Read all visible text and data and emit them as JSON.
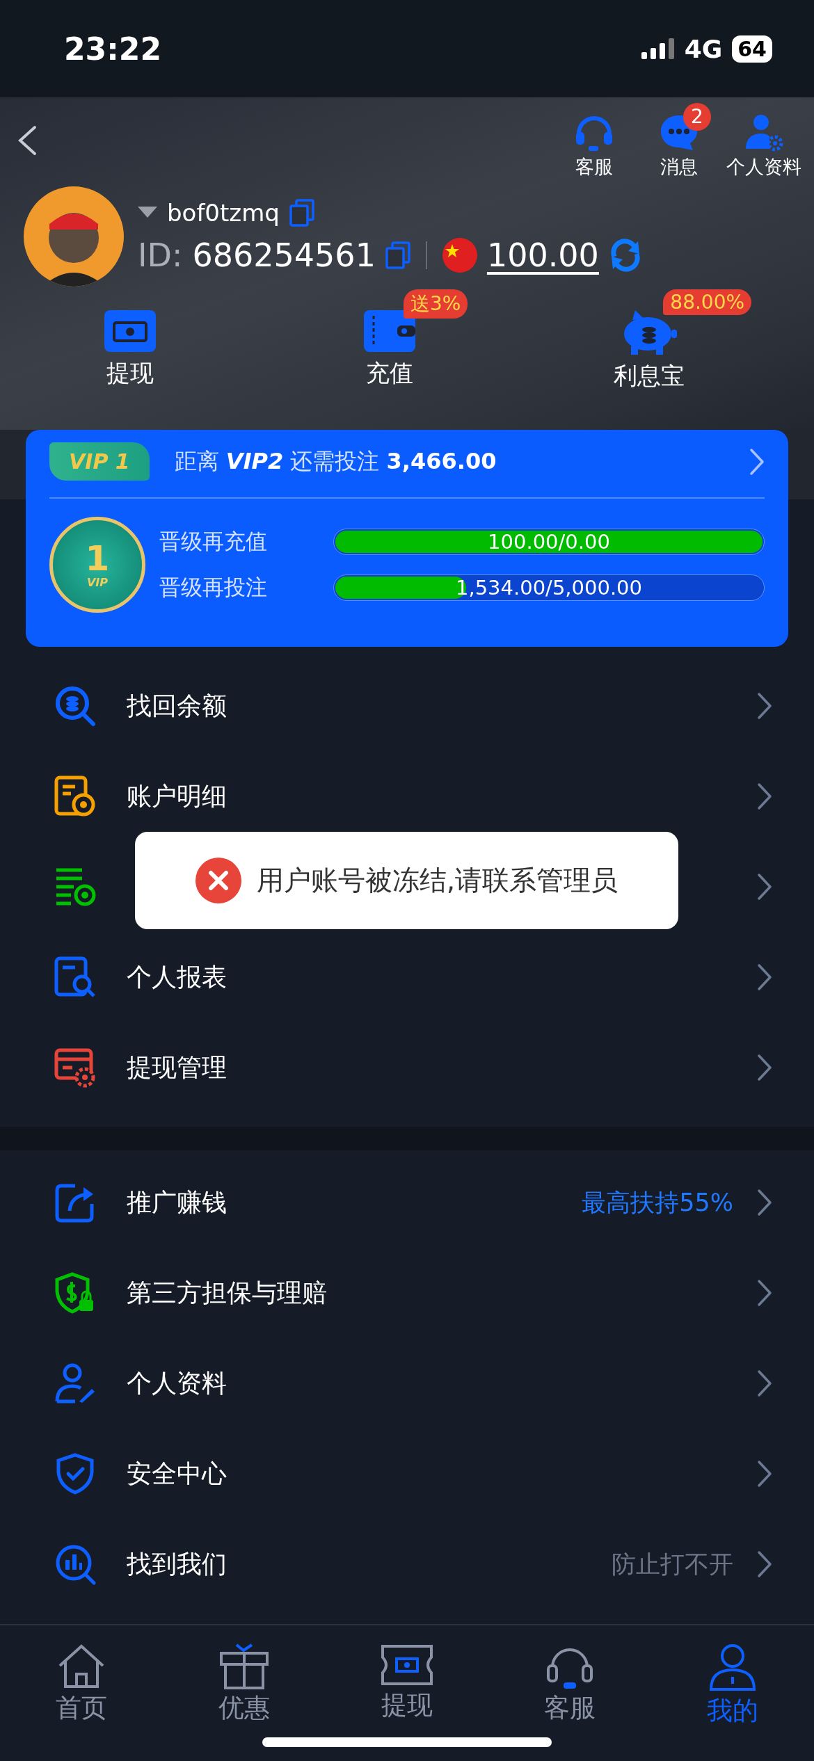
{
  "status_bar": {
    "time": "23:22",
    "network": "4G",
    "battery": "64"
  },
  "header": {
    "actions": [
      {
        "label": "客服"
      },
      {
        "label": "消息",
        "badge": "2"
      },
      {
        "label": "个人资料"
      }
    ],
    "username": "bof0tzmq",
    "id_label": "ID:",
    "id_value": "686254561",
    "balance": "100.00"
  },
  "quick_actions": [
    {
      "label": "提现"
    },
    {
      "label": "充值",
      "badge": "送3%"
    },
    {
      "label": "利息宝",
      "badge": "88.00%"
    }
  ],
  "vip_card": {
    "badge": "VIP 1",
    "summary": "距离 **VIP2** 还需投注 **3,466.00**",
    "medal": {
      "number": "1",
      "caption": "VIP"
    },
    "progress": [
      {
        "label": "晋级再充值",
        "reading": "100.00/0.00",
        "level": 1
      },
      {
        "label": "晋级再投注",
        "reading": "1,534.00/5,000.00",
        "level": 0.307
      }
    ]
  },
  "menu_section_1": [
    {
      "kind": "plain",
      "label": "找回余额"
    },
    {
      "kind": "plain",
      "label": "账户明细"
    },
    {
      "kind": "covered"
    },
    {
      "kind": "plain",
      "label": "个人报表"
    },
    {
      "kind": "plain",
      "label": "提现管理"
    }
  ],
  "menu_section_2": [
    {
      "kind": "plain",
      "label": "推广赚钱",
      "note": {
        "text": "最高扶持55%",
        "color": "#1f78ff"
      }
    },
    {
      "kind": "plain",
      "label": "第三方担保与理赔"
    },
    {
      "kind": "plain",
      "label": "个人资料"
    },
    {
      "kind": "plain",
      "label": "安全中心"
    },
    {
      "kind": "plain",
      "label": "找到我们",
      "note": {
        "text": "防止打不开",
        "color": "#6c7688"
      }
    }
  ],
  "toast": {
    "message": "用户账号被冻结,请联系管理员"
  },
  "tab_bar": [
    {
      "label": "首页",
      "selected": false
    },
    {
      "label": "优惠",
      "selected": false
    },
    {
      "label": "提现",
      "selected": false
    },
    {
      "label": "客服",
      "selected": false
    },
    {
      "label": "我的",
      "selected": true
    }
  ]
}
